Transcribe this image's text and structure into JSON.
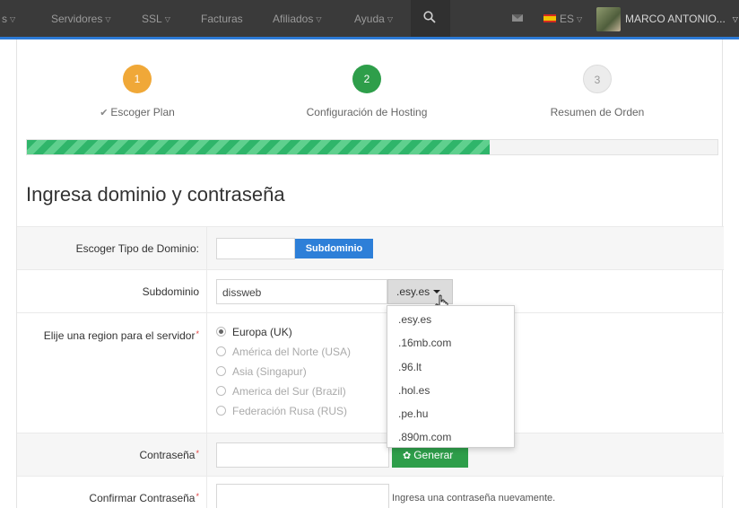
{
  "nav": {
    "items": [
      {
        "label": "s"
      },
      {
        "label": "Servidores"
      },
      {
        "label": "SSL"
      },
      {
        "label": "Facturas"
      },
      {
        "label": "Afiliados"
      },
      {
        "label": "Ayuda"
      }
    ],
    "language": "ES",
    "user_name": "MARCO ANTONIO...",
    "accent_color": "#2c7ad6"
  },
  "steps": [
    {
      "number": "1",
      "label": "Escoger Plan",
      "color": "#f0a838"
    },
    {
      "number": "2",
      "label": "Configuración de Hosting",
      "color": "#2e9e4a"
    },
    {
      "number": "3",
      "label": "Resumen de Orden",
      "color": "#e4e4e4"
    }
  ],
  "progress_fraction": 0.67,
  "heading": "Ingresa dominio y contraseña",
  "form": {
    "domain_type": {
      "label": "Escoger Tipo de Dominio:",
      "option_label": "Subdominio"
    },
    "subdomain": {
      "label": "Subdominio",
      "value": "dissweb",
      "selected_extension": ".esy.es",
      "extensions": [
        ".esy.es",
        ".16mb.com",
        ".96.lt",
        ".hol.es",
        ".pe.hu",
        ".890m.com"
      ]
    },
    "region": {
      "label": "Elije una region para el servidor",
      "options": [
        "Europa (UK)",
        "América del Norte (USA)",
        "Asia (Singapur)",
        "America del Sur (Brazil)",
        "Federación Rusa (RUS)"
      ],
      "selected": "Europa (UK)"
    },
    "password": {
      "label": "Contraseña",
      "generate_label": "Generar"
    },
    "confirm_password": {
      "label": "Confirmar Contraseña",
      "hint": "Ingresa una contraseña nuevamente."
    },
    "required_mark": "*"
  }
}
